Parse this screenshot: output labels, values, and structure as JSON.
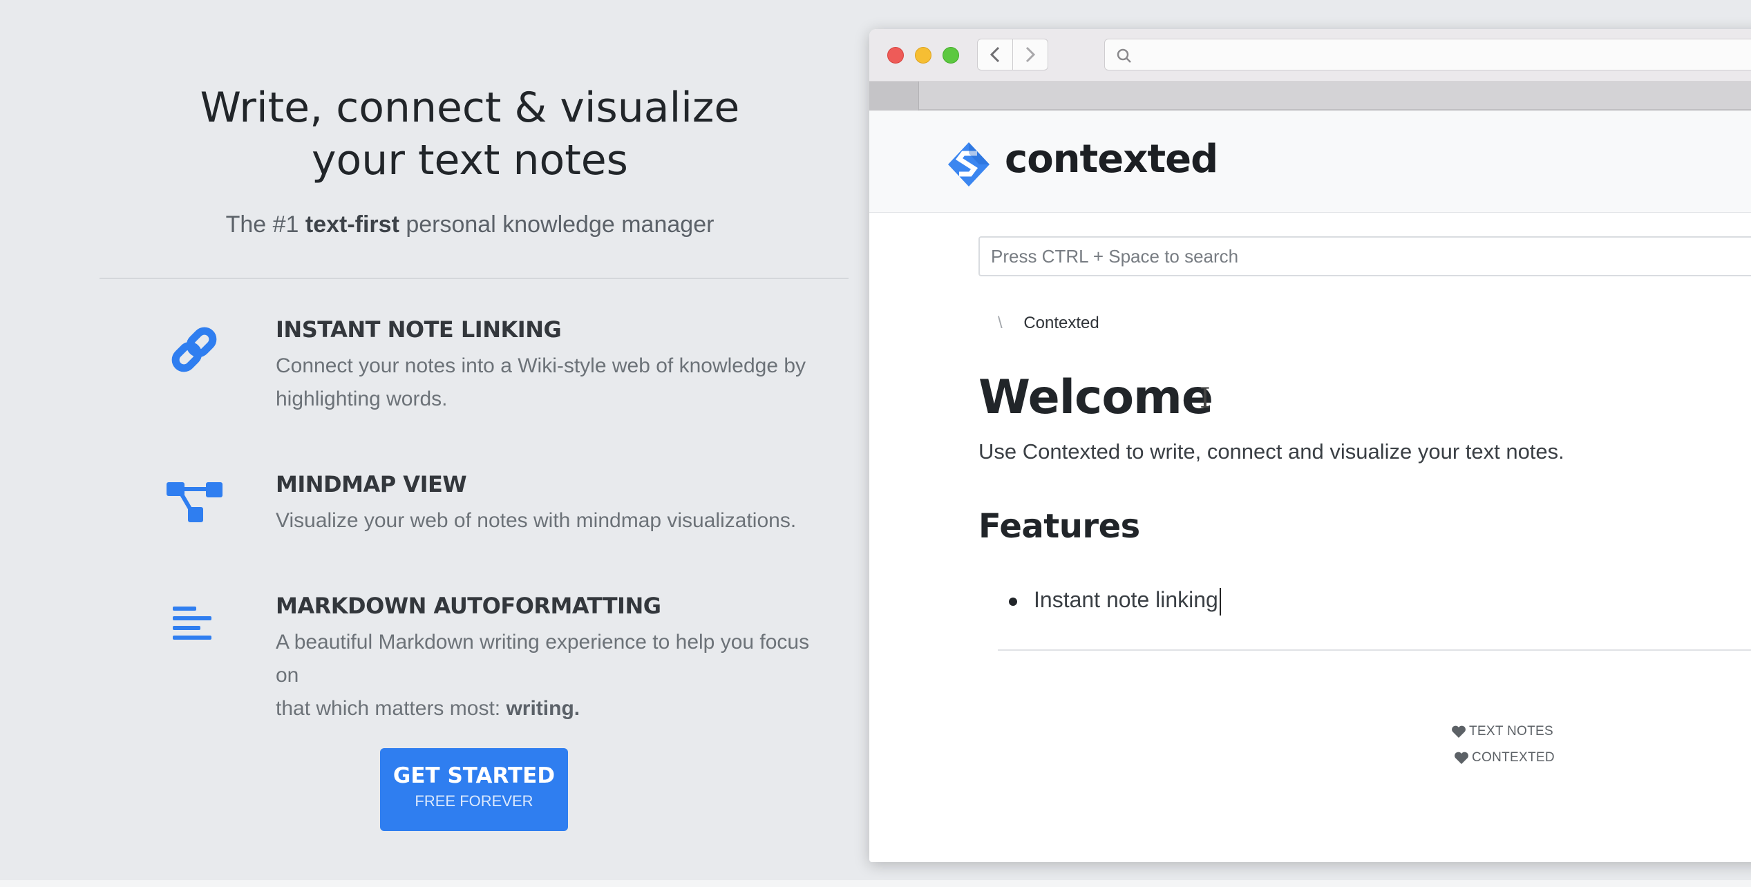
{
  "hero": {
    "title_line1": "Write, connect & visualize",
    "title_line2": "your text notes",
    "subtitle_prefix": "The #1 ",
    "subtitle_bold": "text-first",
    "subtitle_suffix": " personal knowledge manager"
  },
  "features": [
    {
      "icon": "link-icon",
      "title": "INSTANT NOTE LINKING",
      "desc_line1": "Connect your notes into a Wiki-style web of knowledge by",
      "desc_line2": "highlighting words."
    },
    {
      "icon": "mindmap-icon",
      "title": "MINDMAP VIEW",
      "desc_line1": "Visualize your web of notes with mindmap visualizations."
    },
    {
      "icon": "align-left-icon",
      "title": "MARKDOWN AUTOFORMATTING",
      "desc_line1": "A beautiful Markdown writing experience to help you focus on",
      "desc_line2_prefix": "that which matters most: ",
      "desc_line2_bold": "writing."
    }
  ],
  "cta": {
    "main": "GET STARTED",
    "sub": "FREE FOREVER"
  },
  "colors": {
    "accent": "#2f7ef0",
    "page_bg": "#e8eaed"
  },
  "app": {
    "brand": "contexted",
    "search_placeholder": "Press CTRL + Space to search",
    "breadcrumb_sep": "\\",
    "breadcrumb_item": "Contexted",
    "doc_title": "Welcome",
    "doc_paragraph": "Use Contexted to write, connect and visualize your text notes.",
    "doc_heading": "Features",
    "doc_list": [
      "Instant note linking"
    ],
    "tags": [
      "TEXT NOTES",
      "CONTEXTED"
    ]
  }
}
